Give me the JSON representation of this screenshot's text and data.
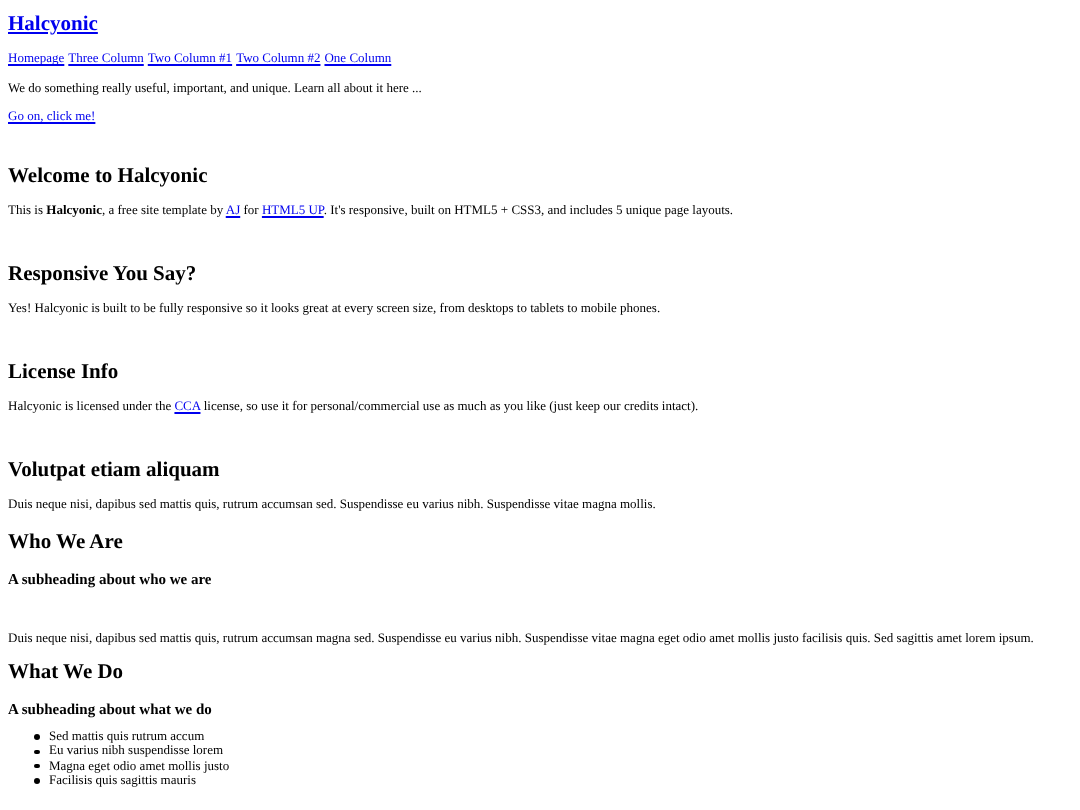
{
  "site_title": "Halcyonic",
  "nav": [
    {
      "label": "Homepage"
    },
    {
      "label": "Three Column"
    },
    {
      "label": "Two Column #1"
    },
    {
      "label": "Two Column #2"
    },
    {
      "label": "One Column"
    }
  ],
  "tagline": "We do something really useful, important, and unique. Learn all about it here ...",
  "cta_link": "Go on, click me!",
  "sections": [
    {
      "heading": "Welcome to Halcyonic",
      "parts": [
        {
          "kind": "text",
          "text": "This is "
        },
        {
          "kind": "bold",
          "text": "Halcyonic"
        },
        {
          "kind": "text",
          "text": ", a free site template by "
        },
        {
          "kind": "link",
          "text": "AJ"
        },
        {
          "kind": "text",
          "text": " for "
        },
        {
          "kind": "link",
          "text": "HTML5 UP"
        },
        {
          "kind": "text",
          "text": ". It's responsive, built on HTML5 + CSS3, and includes 5 unique page layouts."
        }
      ]
    },
    {
      "heading": "Responsive You Say?",
      "parts": [
        {
          "kind": "text",
          "text": "Yes! Halcyonic is built to be fully responsive so it looks great at every screen size, from desktops to tablets to mobile phones."
        }
      ]
    },
    {
      "heading": "License Info",
      "parts": [
        {
          "kind": "text",
          "text": "Halcyonic is licensed under the "
        },
        {
          "kind": "link",
          "text": "CCA"
        },
        {
          "kind": "text",
          "text": " license, so use it for personal/commercial use as much as you like (just keep our credits intact)."
        }
      ]
    },
    {
      "heading": "Volutpat etiam aliquam",
      "parts": [
        {
          "kind": "text",
          "text": "Duis neque nisi, dapibus sed mattis quis, rutrum accumsan sed. Suspendisse eu varius nibh. Suspendisse vitae magna mollis."
        }
      ]
    }
  ],
  "who_we_are": {
    "heading": "Who We Are",
    "subheading": "A subheading about who we are",
    "paragraph": "Duis neque nisi, dapibus sed mattis quis, rutrum accumsan magna sed. Suspendisse eu varius nibh. Suspendisse vitae magna eget odio amet mollis justo facilisis quis. Sed sagittis amet lorem ipsum."
  },
  "what_we_do": {
    "heading": "What We Do",
    "subheading": "A subheading about what we do",
    "items": [
      "Sed mattis quis rutrum accum",
      "Eu varius nibh suspendisse lorem",
      "Magna eget odio amet mollis justo",
      "Facilisis quis sagittis mauris"
    ]
  }
}
